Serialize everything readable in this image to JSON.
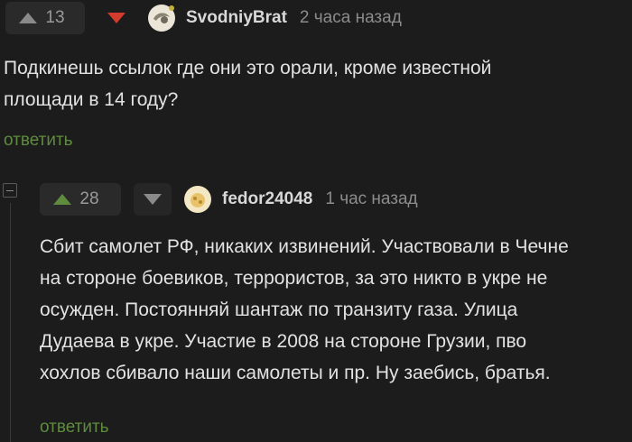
{
  "comments": [
    {
      "score": "13",
      "username": "SvodniyBrat",
      "time": "2 часа назад",
      "text": "Подкинешь ссылок где они это орали, кроме известной\nплощади в 14 году?",
      "reply_label": "ответить",
      "vote_state": "downvoted"
    },
    {
      "score": "28",
      "username": "fedor24048",
      "time": "1 час назад",
      "text": "Сбит самолет РФ, никаких извинений. Участвовали в Чечне\nна стороне боевиков, террористов, за это никто в укре не\nосужден. Постоянняй шантаж по транзиту газа. Улица\nДудаева в укре. Участие в 2008 на стороне Грузии, пво\nхохлов сбивало наши самолеты и пр. Ну заебись, братья.",
      "reply_label": "ответить",
      "vote_state": "upvoted"
    }
  ],
  "colors": {
    "background": "#1c1c1c",
    "upvote_active": "#5f8b3e",
    "downvote_active": "#d33b2c",
    "inactive_arrow": "#8a8a8a",
    "reply_link": "#5f8b3e"
  },
  "icons": {
    "upvote": "triangle-up",
    "downvote": "triangle-down",
    "collapse": "minus-square"
  }
}
